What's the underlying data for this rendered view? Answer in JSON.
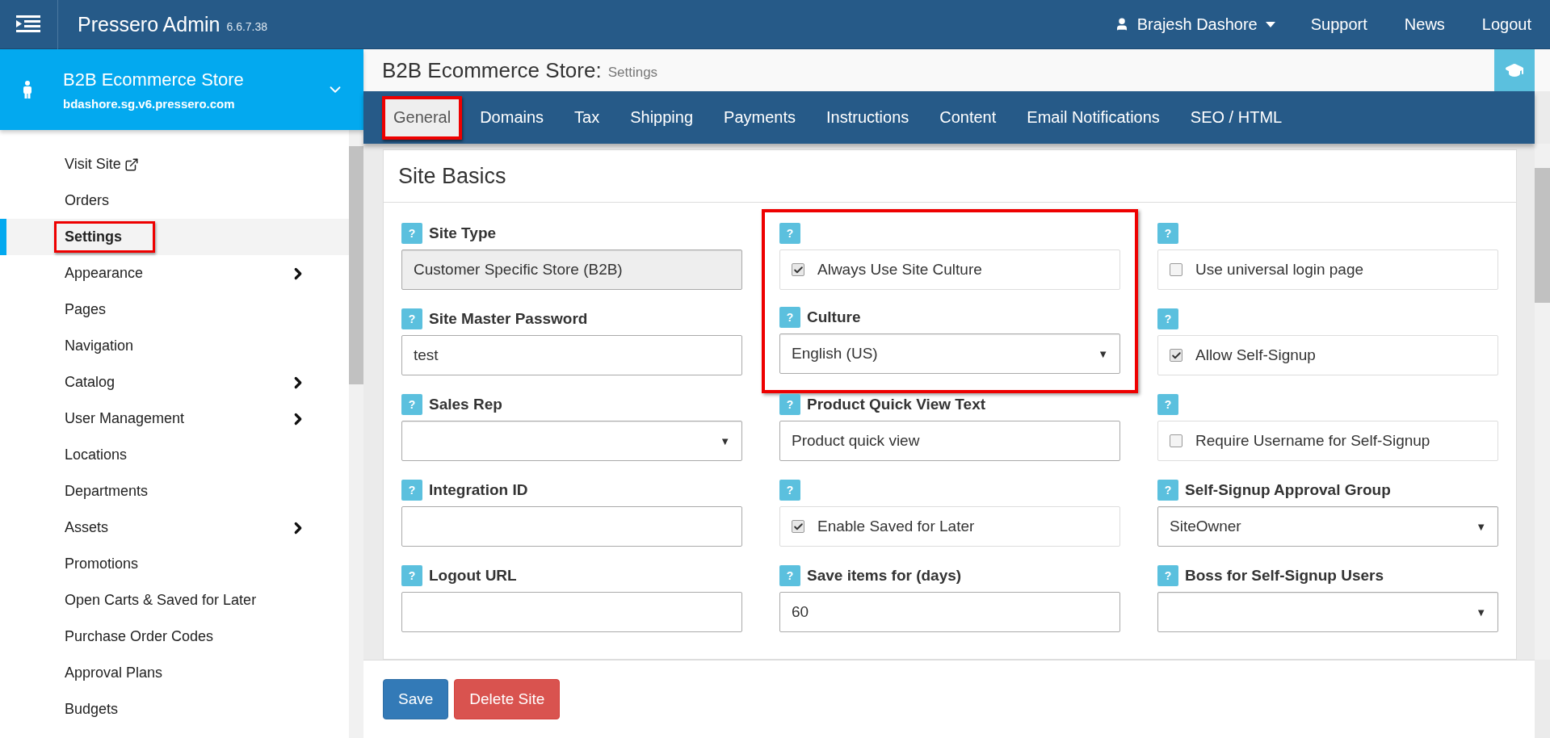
{
  "topbar": {
    "app_title": "Pressero Admin",
    "version": "6.6.7.38",
    "user": "Brajesh Dashore",
    "links": [
      "Support",
      "News",
      "Logout"
    ]
  },
  "sidebar": {
    "store_name": "B2B Ecommerce Store",
    "store_url": "bdashore.sg.v6.pressero.com",
    "items": [
      {
        "label": "Visit Site",
        "selected": false,
        "highlighted": false,
        "external": true,
        "submenu": false
      },
      {
        "label": "Orders",
        "selected": false,
        "highlighted": false,
        "external": false,
        "submenu": false
      },
      {
        "label": "Settings",
        "selected": true,
        "highlighted": true,
        "external": false,
        "submenu": false
      },
      {
        "label": "Appearance",
        "selected": false,
        "highlighted": false,
        "external": false,
        "submenu": true
      },
      {
        "label": "Pages",
        "selected": false,
        "highlighted": false,
        "external": false,
        "submenu": false
      },
      {
        "label": "Navigation",
        "selected": false,
        "highlighted": false,
        "external": false,
        "submenu": false
      },
      {
        "label": "Catalog",
        "selected": false,
        "highlighted": false,
        "external": false,
        "submenu": true
      },
      {
        "label": "User Management",
        "selected": false,
        "highlighted": false,
        "external": false,
        "submenu": true
      },
      {
        "label": "Locations",
        "selected": false,
        "highlighted": false,
        "external": false,
        "submenu": false
      },
      {
        "label": "Departments",
        "selected": false,
        "highlighted": false,
        "external": false,
        "submenu": false
      },
      {
        "label": "Assets",
        "selected": false,
        "highlighted": false,
        "external": false,
        "submenu": true
      },
      {
        "label": "Promotions",
        "selected": false,
        "highlighted": false,
        "external": false,
        "submenu": false
      },
      {
        "label": "Open Carts & Saved for Later",
        "selected": false,
        "highlighted": false,
        "external": false,
        "submenu": false
      },
      {
        "label": "Purchase Order Codes",
        "selected": false,
        "highlighted": false,
        "external": false,
        "submenu": false
      },
      {
        "label": "Approval Plans",
        "selected": false,
        "highlighted": false,
        "external": false,
        "submenu": false
      },
      {
        "label": "Budgets",
        "selected": false,
        "highlighted": false,
        "external": false,
        "submenu": false
      }
    ]
  },
  "page": {
    "title": "B2B Ecommerce Store:",
    "subtitle": "Settings"
  },
  "tabs": [
    {
      "label": "General",
      "selected": true,
      "highlighted": true
    },
    {
      "label": "Domains",
      "selected": false,
      "highlighted": false
    },
    {
      "label": "Tax",
      "selected": false,
      "highlighted": false
    },
    {
      "label": "Shipping",
      "selected": false,
      "highlighted": false
    },
    {
      "label": "Payments",
      "selected": false,
      "highlighted": false
    },
    {
      "label": "Instructions",
      "selected": false,
      "highlighted": false
    },
    {
      "label": "Content",
      "selected": false,
      "highlighted": false
    },
    {
      "label": "Email Notifications",
      "selected": false,
      "highlighted": false
    },
    {
      "label": "SEO / HTML",
      "selected": false,
      "highlighted": false
    }
  ],
  "panel": {
    "title": "Site Basics",
    "columns": [
      [
        {
          "kind": "readonly",
          "help": "?",
          "label": "Site Type",
          "value": "Customer Specific Store (B2B)"
        },
        {
          "kind": "input",
          "help": "?",
          "label": "Site Master Password",
          "value": "test"
        },
        {
          "kind": "select",
          "help": "?",
          "label": "Sales Rep",
          "caret": "▼"
        },
        {
          "kind": "input",
          "help": "?",
          "label": "Integration ID"
        },
        {
          "kind": "input",
          "help": "?",
          "label": "Logout URL"
        }
      ],
      [
        {
          "kind": "group",
          "highlighted": true,
          "fields": [
            {
              "kind": "checkbox",
              "help": "?",
              "text": "Always Use Site Culture",
              "checked": true
            },
            {
              "kind": "select",
              "help": "?",
              "label": "Culture",
              "value": "English (US)",
              "caret": "▼"
            }
          ]
        },
        {
          "kind": "input",
          "help": "?",
          "label": "Product Quick View Text",
          "value": "Product quick view"
        },
        {
          "kind": "checkbox",
          "help": "?",
          "text": "Enable Saved for Later",
          "checked": true
        },
        {
          "kind": "input",
          "help": "?",
          "label": "Save items for (days)",
          "value": "60"
        }
      ],
      [
        {
          "kind": "checkbox",
          "help": "?",
          "text": "Use universal login page",
          "checked": false
        },
        {
          "kind": "checkbox",
          "help": "?",
          "text": "Allow Self-Signup",
          "checked": true
        },
        {
          "kind": "checkbox",
          "help": "?",
          "text": "Require Username for Self-Signup",
          "checked": false
        },
        {
          "kind": "select",
          "help": "?",
          "label": "Self-Signup Approval Group",
          "value": "SiteOwner",
          "caret": "▼"
        },
        {
          "kind": "select",
          "help": "?",
          "label": "Boss for Self-Signup Users",
          "caret": "▼"
        }
      ]
    ]
  },
  "buttons": [
    {
      "label": "Save",
      "kind": "primary"
    },
    {
      "label": "Delete Site",
      "kind": "danger"
    }
  ]
}
